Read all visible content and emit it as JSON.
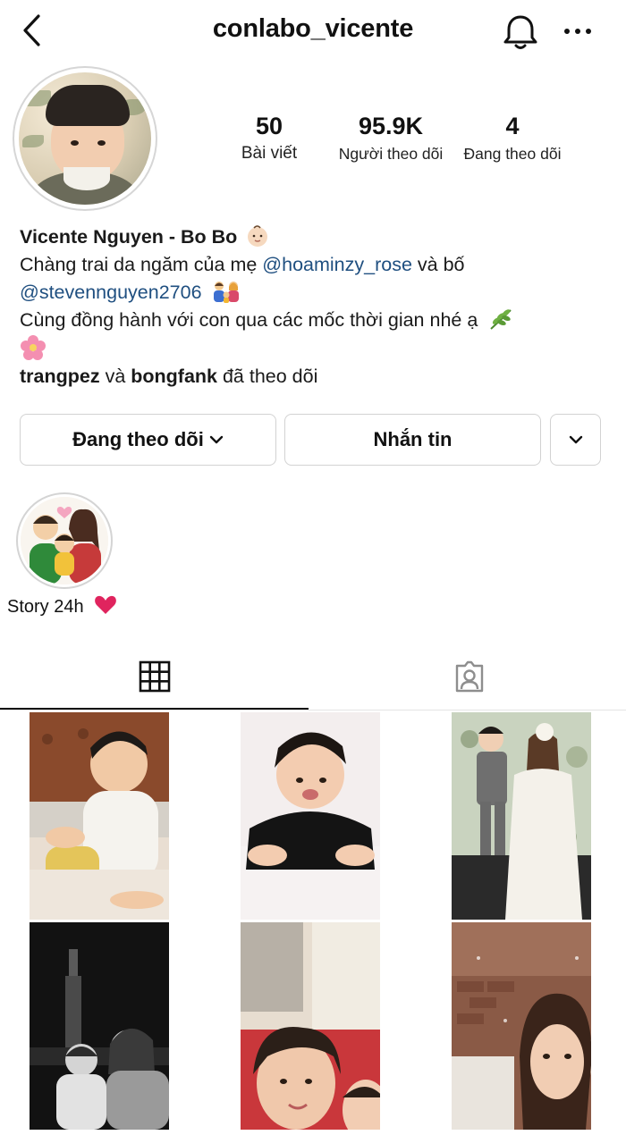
{
  "header": {
    "username": "conlabo_vicente",
    "back_icon": "chevron-left-icon",
    "bell_icon": "bell-icon",
    "more_icon": "more-horizontal-icon"
  },
  "profile": {
    "stats": [
      {
        "value": "50",
        "label": "Bài viết"
      },
      {
        "value": "95.9K",
        "label": "Người theo dõi"
      },
      {
        "value": "4",
        "label": "Đang theo dõi"
      }
    ],
    "display_name": "Vicente Nguyen - Bo Bo",
    "bio": {
      "line1_text": "Chàng trai da ngăm của mẹ ",
      "mention1": "@hoaminzy_rose",
      "line1_tail": " và bố",
      "mention2": "@stevennguyen2706",
      "line3": "Cùng đồng hành với con qua các mốc thời gian nhé ạ"
    },
    "followed_by": {
      "user1": "trangpez",
      "conj": " và ",
      "user2": "bongfank",
      "tail": " đã theo dõi"
    }
  },
  "actions": {
    "following_label": "Đang theo dõi",
    "message_label": "Nhắn tin"
  },
  "highlights": [
    {
      "label": "Story 24h"
    }
  ],
  "tabs": [
    {
      "name": "posts-grid",
      "icon": "grid-icon",
      "active": true
    },
    {
      "name": "tagged",
      "icon": "tagged-person-icon",
      "active": false
    }
  ],
  "posts_count_visible": 6,
  "colors": {
    "link": "#1f4f80",
    "border": "#d2d2d2",
    "heart": "#e0245e"
  }
}
